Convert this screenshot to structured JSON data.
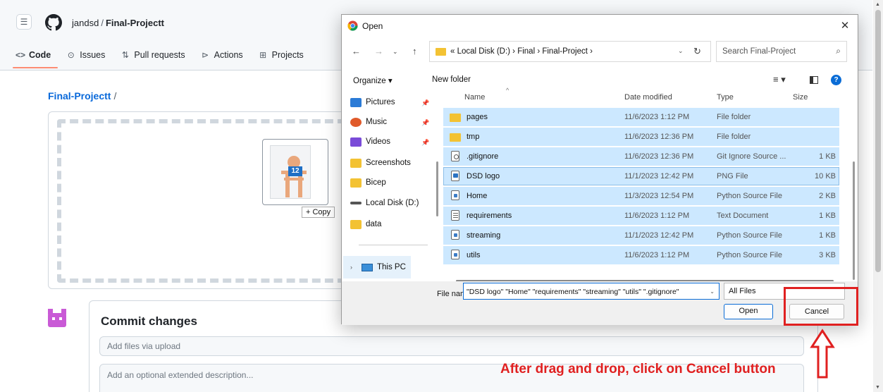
{
  "github": {
    "owner": "jandsd",
    "repo": "Final-Projectt",
    "tabs": [
      {
        "label": "Code",
        "icon": "code-icon"
      },
      {
        "label": "Issues",
        "icon": "issue-icon"
      },
      {
        "label": "Pull requests",
        "icon": "pull-request-icon"
      },
      {
        "label": "Actions",
        "icon": "play-icon"
      },
      {
        "label": "Projects",
        "icon": "table-icon"
      }
    ],
    "breadcrumb_repo": "Final-Projectt",
    "breadcrumb_sep": "/",
    "drag_badge": "12",
    "copy_tooltip": "+ Copy",
    "commit_title": "Commit changes",
    "commit_summary_placeholder": "Add files via upload",
    "commit_description_placeholder": "Add an optional extended description..."
  },
  "dialog": {
    "title": "Open",
    "address": "« Local Disk (D:) › Final › Final-Project ›",
    "search_placeholder": "Search Final-Project",
    "organize_label": "Organize ▾",
    "new_folder_label": "New folder",
    "nav_items": [
      {
        "label": "Pictures",
        "color": "#2b7bd6",
        "pinned": true
      },
      {
        "label": "Music",
        "color": "#e05a2a",
        "pinned": true
      },
      {
        "label": "Videos",
        "color": "#7a4bd8",
        "pinned": true
      },
      {
        "label": "Screenshots",
        "color": "#f3c233",
        "pinned": false
      },
      {
        "label": "Bicep",
        "color": "#f3c233",
        "pinned": false
      },
      {
        "label": "Local Disk (D:)",
        "color": "#666666",
        "pinned": false
      },
      {
        "label": "data",
        "color": "#f3c233",
        "pinned": false
      }
    ],
    "this_pc": "This PC",
    "columns": {
      "name": "Name",
      "date": "Date modified",
      "type": "Type",
      "size": "Size"
    },
    "files": [
      {
        "name": "pages",
        "date": "11/6/2023 1:12 PM",
        "type": "File folder",
        "size": "",
        "icon": "folder"
      },
      {
        "name": "tmp",
        "date": "11/6/2023 12:36 PM",
        "type": "File folder",
        "size": "",
        "icon": "folder"
      },
      {
        "name": ".gitignore",
        "date": "11/6/2023 12:36 PM",
        "type": "Git Ignore Source ...",
        "size": "1 KB",
        "icon": "git"
      },
      {
        "name": "DSD logo",
        "date": "11/1/2023 12:42 PM",
        "type": "PNG File",
        "size": "10 KB",
        "icon": "png"
      },
      {
        "name": "Home",
        "date": "11/3/2023 12:54 PM",
        "type": "Python Source File",
        "size": "2 KB",
        "icon": "py"
      },
      {
        "name": "requirements",
        "date": "11/6/2023 1:12 PM",
        "type": "Text Document",
        "size": "1 KB",
        "icon": "txt"
      },
      {
        "name": "streaming",
        "date": "11/1/2023 12:42 PM",
        "type": "Python Source File",
        "size": "1 KB",
        "icon": "py"
      },
      {
        "name": "utils",
        "date": "11/6/2023 1:12 PM",
        "type": "Python Source File",
        "size": "3 KB",
        "icon": "py"
      }
    ],
    "file_name_label": "File name:",
    "file_name_value": "\"DSD logo\" \"Home\" \"requirements\" \"streaming\" \"utils\" \".gitignore\"",
    "file_type": "All Files",
    "open_label": "Open",
    "cancel_label": "Cancel"
  },
  "annotation": {
    "text": "After drag and drop, click on Cancel button",
    "color": "#e02020"
  }
}
